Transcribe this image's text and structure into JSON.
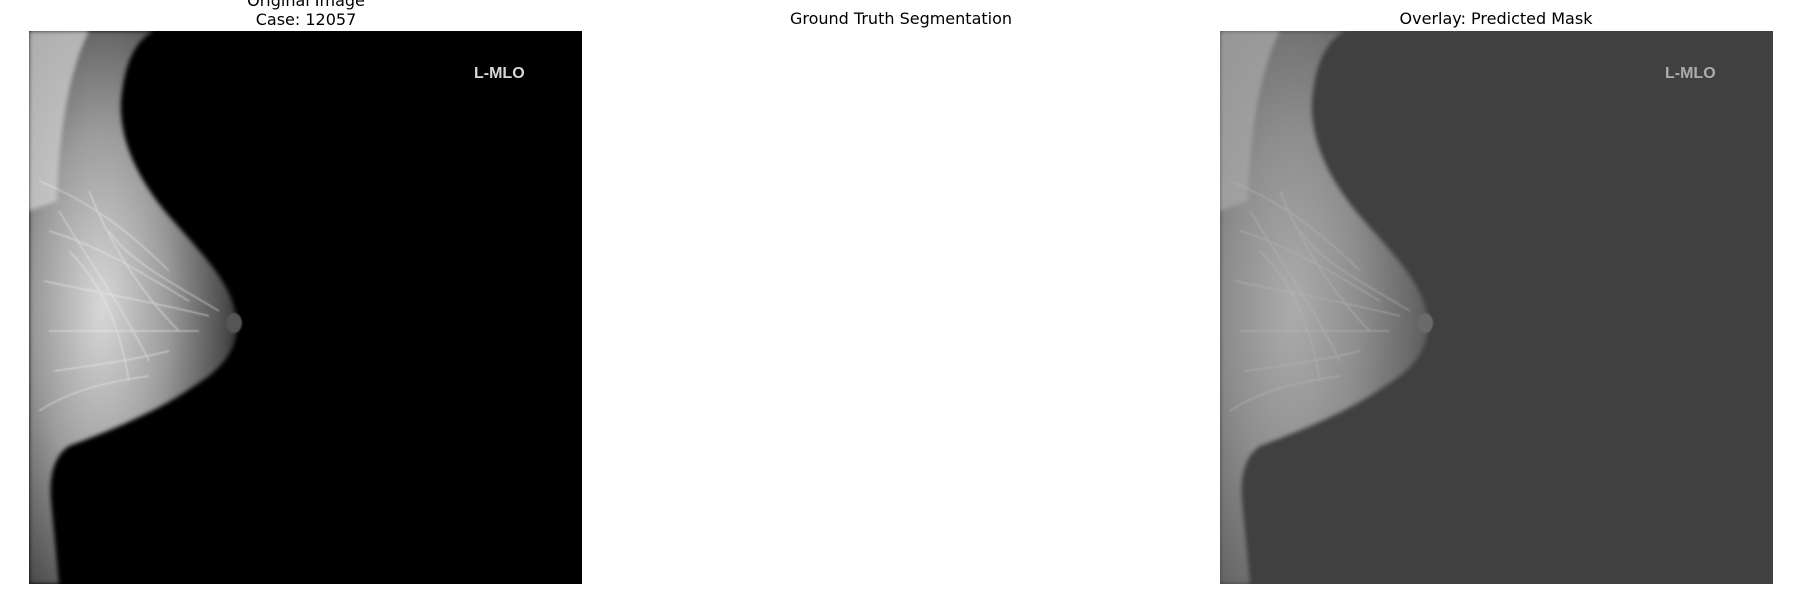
{
  "panels": {
    "original": {
      "title_line1": "Original Image",
      "title_line2": "Case: 12057",
      "view_label": "L-MLO"
    },
    "ground_truth": {
      "title": "Ground Truth Segmentation"
    },
    "overlay": {
      "title": "Overlay: Predicted Mask",
      "view_label": "L-MLO"
    }
  },
  "colors": {
    "background": "#000000",
    "tissue_light": "#e6e6e6",
    "overlay_gray": "#808080",
    "label_text": "#d8d8d8"
  }
}
